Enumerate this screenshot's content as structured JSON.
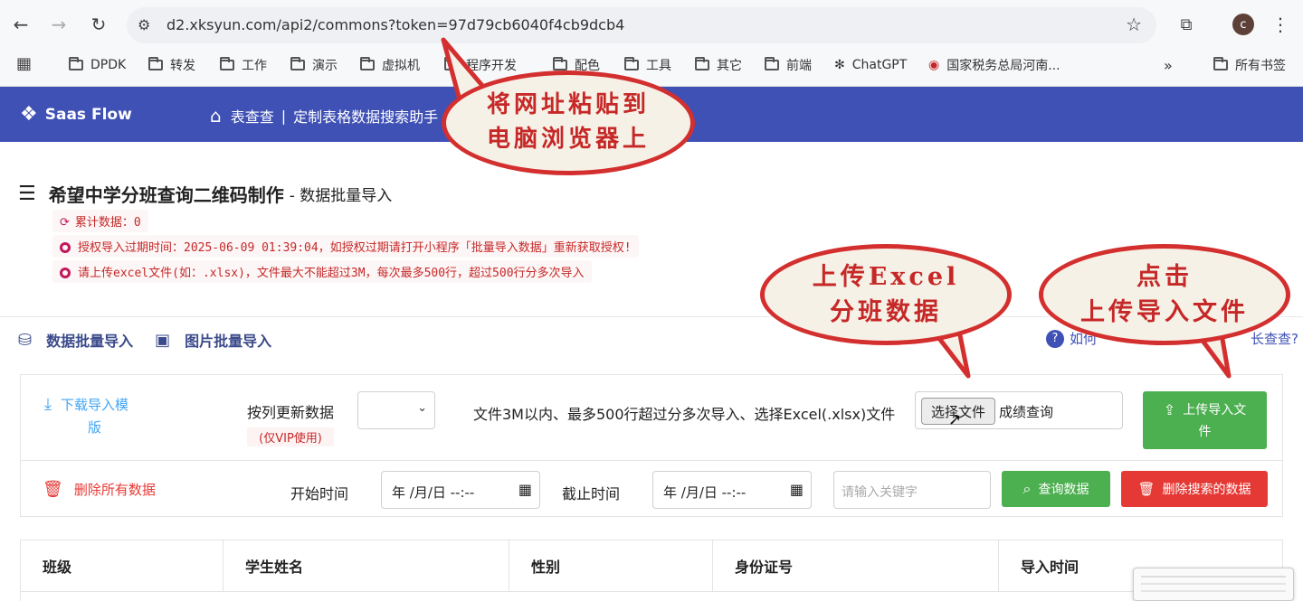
{
  "browser": {
    "url": "d2.xksyun.com/api2/commons?token=97d79cb6040f4cb9dcb4",
    "profile_initial": "c",
    "bookmarks": [
      "DPDK",
      "转发",
      "工作",
      "演示",
      "虚拟机",
      "程序开发",
      "配色",
      "工具",
      "其它",
      "前端",
      "ChatGPT",
      "国家税务总局河南...",
      "所有书签"
    ]
  },
  "app": {
    "brand": "Saas Flow",
    "crumb_home": "表查查",
    "crumb_title": "定制表格数据搜索助手"
  },
  "page": {
    "title": "希望中学分班查询二维码制作",
    "subtitle": "- 数据批量导入",
    "count_note": "累计数据：0",
    "expiry_note": "授权导入过期时间：2025-06-09 01:39:04，如授权过期请打开小程序「批量导入数据」重新获取授权!",
    "upload_note": "请上传excel文件(如：.xlsx)，文件最大不能超过3M，每次最多500行，超过500行分多次导入"
  },
  "tabs": {
    "data_import": "数据批量导入",
    "image_import": "图片批量导入",
    "help_left": "如何",
    "help_right": "长查查?"
  },
  "form": {
    "download_template": "下载导入模版",
    "download_template_l1": "下载导入模",
    "download_template_l2": "版",
    "update_by_col": "按列更新数据",
    "vip_only": "(仅VIP使用)",
    "file_hint": "文件3M以内、最多500行超过分多次导入、选择Excel(.xlsx)文件",
    "choose_file": "选择文件",
    "chosen_file": "成绩查询",
    "upload_btn_l1": "上传导入文",
    "upload_btn_l2": "件",
    "delete_all": "删除所有数据",
    "start_time": "开始时间",
    "end_time": "截止时间",
    "date_placeholder": "年 /月/日 --:--",
    "keyword_placeholder": "请输入关键字",
    "query_btn": "查询数据",
    "delete_search_btn": "删除搜索的数据"
  },
  "table": {
    "columns": [
      "班级",
      "学生姓名",
      "性别",
      "身份证号",
      "导入时间"
    ]
  },
  "annotations": {
    "bubble1_l1": "将网址粘贴到",
    "bubble1_l2": "电脑浏览器上",
    "bubble2_l1": "上传Excel",
    "bubble2_l2": "分班数据",
    "bubble3_l1": "点击",
    "bubble3_l2": "上传导入文件"
  },
  "colors": {
    "appbar": "#3f51b5",
    "green": "#4caf50",
    "red": "#e53935",
    "bubble_border": "#d32f2f"
  }
}
